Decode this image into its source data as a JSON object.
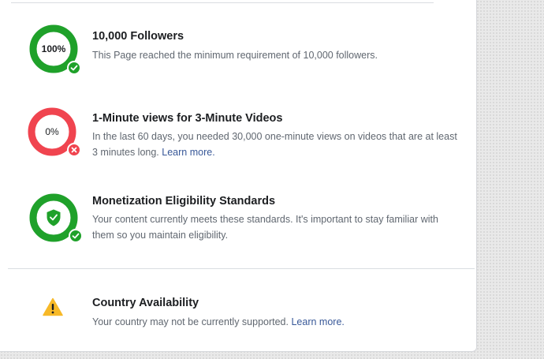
{
  "colors": {
    "success": "#1fa12a",
    "danger": "#f0444f",
    "warning": "#f7b928",
    "link": "#385898"
  },
  "requirements": [
    {
      "title": "10,000 Followers",
      "badge_text": "100%",
      "progress": 1.0,
      "status": "met",
      "icon": "check-icon",
      "description": "This Page reached the minimum requirement of 10,000 followers.",
      "link": ""
    },
    {
      "title": "1-Minute views for 3-Minute Videos",
      "badge_text": "0%",
      "progress": 0.0,
      "status": "not-met",
      "icon": "x-icon",
      "description": "In the last 60 days, you needed 30,000 one-minute views on videos that are at least 3 minutes long.",
      "link": "Learn more."
    },
    {
      "title": "Monetization Eligibility Standards",
      "badge_text": "",
      "progress": 1.0,
      "status": "met",
      "icon": "shield-icon",
      "description": "Your content currently meets these standards. It's important to stay familiar with them so you maintain eligibility.",
      "link": ""
    }
  ],
  "country": {
    "title": "Country Availability",
    "icon": "warning-icon",
    "description": "Your country may not be currently supported.",
    "link": "Learn more."
  }
}
